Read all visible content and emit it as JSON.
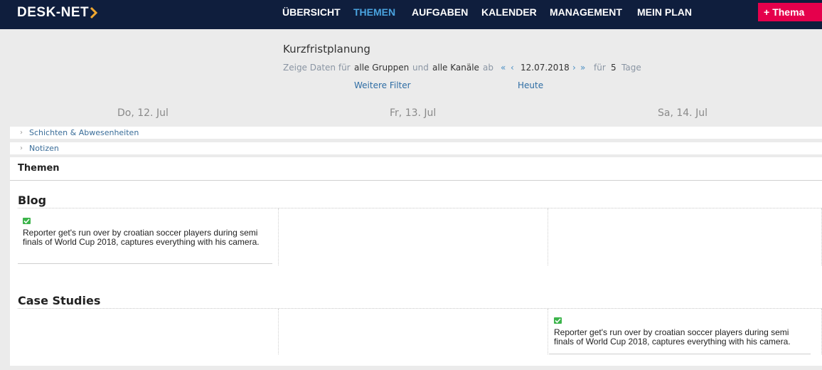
{
  "app": {
    "logo": "DESK-NET",
    "logo_chevron": "chevron-right-icon"
  },
  "nav": {
    "items": [
      {
        "label": "ÜBERSICHT",
        "active": false
      },
      {
        "label": "THEMEN",
        "active": true
      },
      {
        "label": "AUFGABEN",
        "active": false
      },
      {
        "label": "KALENDER",
        "active": false
      },
      {
        "label": "MANAGEMENT",
        "active": false
      },
      {
        "label": "MEIN PLAN",
        "active": false
      }
    ],
    "active_color": "#4aa3df",
    "bar_color": "#0f1e3d"
  },
  "new_button": {
    "plus": "+",
    "label": "Thema",
    "color": "#e5004c"
  },
  "page": {
    "title": "Kurzfristplanung"
  },
  "filter": {
    "prefix": "Zeige Daten für",
    "groups": "alle Gruppen",
    "und": "und",
    "channels": "alle Kanäle",
    "ab": "ab",
    "prev_double": "«",
    "prev": "‹",
    "date": "12.07.2018",
    "next": "›",
    "next_double": "»",
    "fuer": "für",
    "days_count": "5",
    "days_label": "Tage",
    "more_filters": "Weitere Filter",
    "today": "Heute"
  },
  "days": [
    "Do, 12. Jul",
    "Fr, 13. Jul",
    "Sa, 14. Jul"
  ],
  "sections": {
    "shifts": "Schichten & Abwesenheiten",
    "notes": "Notizen",
    "themen": "Themen"
  },
  "groups": [
    {
      "name": "Blog",
      "cards": [
        {
          "day_index": 0,
          "status": "check-icon",
          "text": "Reporter get's run over by croatian soccer players during semi finals of World Cup 2018, captures everything with his camera."
        }
      ]
    },
    {
      "name": "Case Studies",
      "cards": [
        {
          "day_index": 2,
          "status": "check-icon",
          "text": "Reporter get's run over by croatian soccer players during semi finals of World Cup 2018, captures everything with his camera."
        }
      ]
    }
  ]
}
